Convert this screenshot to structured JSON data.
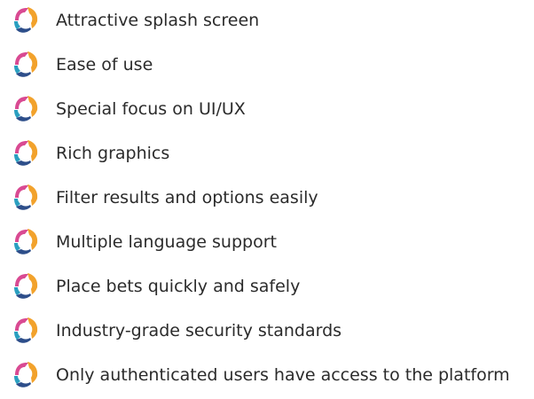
{
  "features": [
    {
      "label": "Attractive splash screen",
      "icon": "swirl-bullet-icon"
    },
    {
      "label": "Ease of use",
      "icon": "swirl-bullet-icon"
    },
    {
      "label": "Special focus on UI/UX",
      "icon": "swirl-bullet-icon"
    },
    {
      "label": "Rich graphics",
      "icon": "swirl-bullet-icon"
    },
    {
      "label": "Filter results and options easily",
      "icon": "swirl-bullet-icon"
    },
    {
      "label": "Multiple language support",
      "icon": "swirl-bullet-icon"
    },
    {
      "label": "Place bets quickly and safely",
      "icon": "swirl-bullet-icon"
    },
    {
      "label": "Industry-grade security standards",
      "icon": "swirl-bullet-icon"
    },
    {
      "label": "Only authenticated users have access to the platform",
      "icon": "swirl-bullet-icon"
    }
  ],
  "icon_colors": {
    "magenta": "#d94a92",
    "orange": "#f2a22c",
    "teal": "#2a9fc0",
    "navy": "#2d4e8a"
  },
  "text_color": "#2b2b2b"
}
